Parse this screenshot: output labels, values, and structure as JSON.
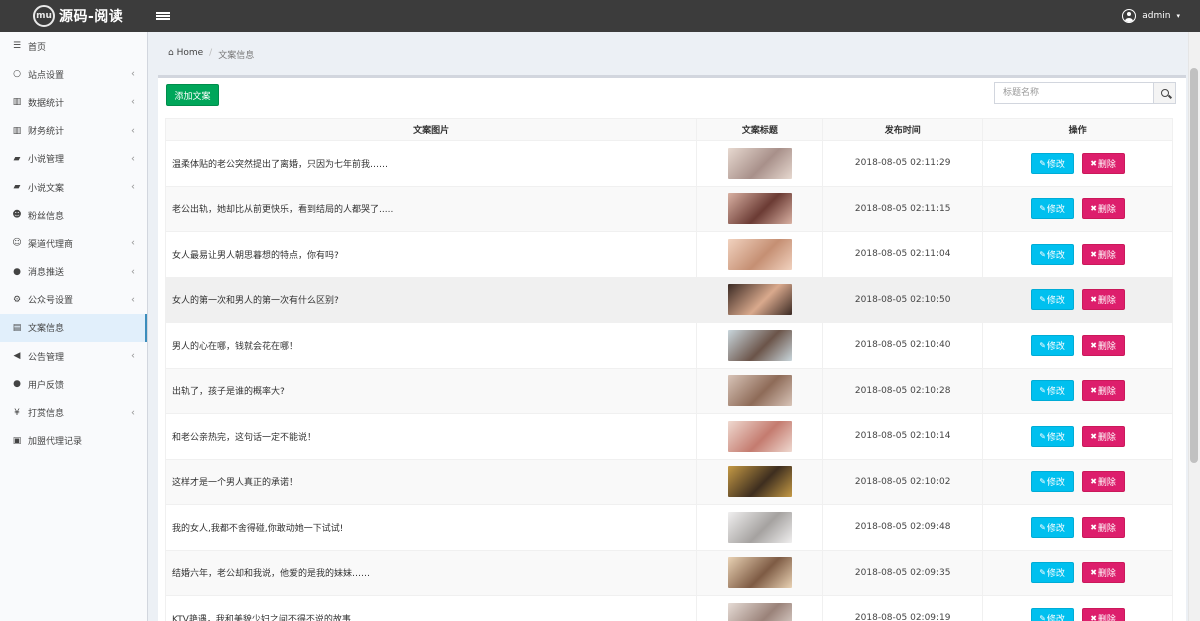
{
  "header": {
    "logo_mark": "mu",
    "app_title": "源码-阅读",
    "user_name": "admin"
  },
  "sidebar": {
    "items": [
      {
        "label": "首页",
        "icon": "dashboard-icon",
        "glyph": "☰",
        "chev": ""
      },
      {
        "label": "站点设置",
        "icon": "circle-icon",
        "glyph": "○",
        "chev": "‹"
      },
      {
        "label": "数据统计",
        "icon": "bar-chart-icon",
        "glyph": "▥",
        "chev": "‹"
      },
      {
        "label": "财务统计",
        "icon": "bar-chart-icon",
        "glyph": "▥",
        "chev": "‹"
      },
      {
        "label": "小说管理",
        "icon": "book-icon",
        "glyph": "▰",
        "chev": "‹"
      },
      {
        "label": "小说文案",
        "icon": "book-icon",
        "glyph": "▰",
        "chev": "‹"
      },
      {
        "label": "粉丝信息",
        "icon": "users-icon",
        "glyph": "☻",
        "chev": ""
      },
      {
        "label": "渠道代理商",
        "icon": "user-plus-icon",
        "glyph": "☺",
        "chev": "‹"
      },
      {
        "label": "消息推送",
        "icon": "comment-icon",
        "glyph": "●",
        "chev": "‹"
      },
      {
        "label": "公众号设置",
        "icon": "cogs-icon",
        "glyph": "⚙",
        "chev": "‹"
      },
      {
        "label": "文案信息",
        "icon": "keyboard-icon",
        "glyph": "▤",
        "chev": "",
        "active": true
      },
      {
        "label": "公告管理",
        "icon": "bullhorn-icon",
        "glyph": "◀",
        "chev": "‹"
      },
      {
        "label": "用户反馈",
        "icon": "comment-icon",
        "glyph": "●",
        "chev": ""
      },
      {
        "label": "打赏信息",
        "icon": "yen-icon",
        "glyph": "¥",
        "chev": "‹"
      },
      {
        "label": "加盟代理记录",
        "icon": "id-card-icon",
        "glyph": "▣",
        "chev": ""
      }
    ]
  },
  "breadcrumb": {
    "home": "Home",
    "current": "文案信息"
  },
  "toolbar": {
    "add_label": "添加文案",
    "search_placeholder": "标题名称"
  },
  "table": {
    "headers": {
      "image": "文案图片",
      "title": "文案标题",
      "time": "发布时间",
      "ops": "操作"
    },
    "edit_label": "修改",
    "delete_label": "删除",
    "rows": [
      {
        "title": "温柔体贴的老公突然提出了离婚，只因为七年前我……",
        "time": "2018-08-05 02:11:29",
        "c1": "#e7d9d0",
        "c2": "#a8908a"
      },
      {
        "title": "老公出轨，她却比从前更快乐，看到结局的人都哭了.....",
        "time": "2018-08-05 02:11:15",
        "c1": "#d9b1a3",
        "c2": "#6b3b34"
      },
      {
        "title": "女人最易让男人朝思暮想的特点，你有吗?",
        "time": "2018-08-05 02:11:04",
        "c1": "#f1d2bf",
        "c2": "#c58f73"
      },
      {
        "title": "女人的第一次和男人的第一次有什么区别?",
        "time": "2018-08-05 02:10:50",
        "c1": "#3b2a24",
        "c2": "#d9a98d"
      },
      {
        "title": "男人的心在哪，钱就会花在哪！",
        "time": "2018-08-05 02:10:40",
        "c1": "#c9d6dc",
        "c2": "#6b5449"
      },
      {
        "title": "出轨了，孩子是谁的概率大?",
        "time": "2018-08-05 02:10:28",
        "c1": "#d8c4b8",
        "c2": "#8e6b58"
      },
      {
        "title": "和老公亲热完，这句话一定不能说！",
        "time": "2018-08-05 02:10:14",
        "c1": "#efd9d0",
        "c2": "#c47b6f"
      },
      {
        "title": "这样才是一个男人真正的承诺！",
        "time": "2018-08-05 02:10:02",
        "c1": "#c59a45",
        "c2": "#3e2e1f"
      },
      {
        "title": "我的女人,我都不舍得碰,你敢动她一下试试!",
        "time": "2018-08-05 02:09:48",
        "c1": "#f0efef",
        "c2": "#a5a2a0"
      },
      {
        "title": "结婚六年，老公却和我说，他爱的是我的妹妹……",
        "time": "2018-08-05 02:09:35",
        "c1": "#e9d2b4",
        "c2": "#7e5b44"
      },
      {
        "title": "KTV艳遇，我和美貌少妇之间不得不说的故事",
        "time": "2018-08-05 02:09:19",
        "c1": "#e6dcd6",
        "c2": "#9a8279"
      }
    ]
  }
}
